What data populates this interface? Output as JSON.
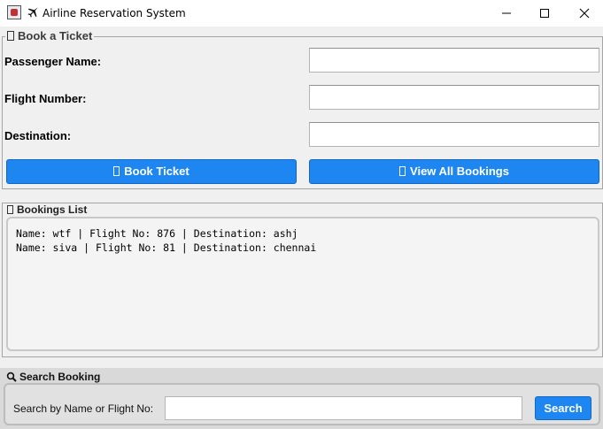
{
  "window": {
    "title": "Airline Reservation System",
    "controls": {
      "minimize": "minimize-icon",
      "maximize": "maximize-icon",
      "close": "close-icon"
    }
  },
  "book_panel": {
    "legend": "Book a Ticket",
    "fields": {
      "passenger_name": {
        "label": "Passenger Name:",
        "value": ""
      },
      "flight_number": {
        "label": "Flight Number:",
        "value": ""
      },
      "destination": {
        "label": "Destination:",
        "value": ""
      }
    },
    "book_button": "Book Ticket",
    "view_button": "View All Bookings"
  },
  "bookings_panel": {
    "legend": "Bookings List",
    "lines": [
      "Name: wtf | Flight No: 876 | Destination: ashj",
      "Name: siva | Flight No: 81 | Destination: chennai"
    ]
  },
  "search_panel": {
    "legend": "Search Booking",
    "label": "Search by Name or Flight No:",
    "value": "",
    "button": "Search"
  },
  "colors": {
    "button_blue": "#1e86f0",
    "window_bg": "#f0f0f0"
  }
}
